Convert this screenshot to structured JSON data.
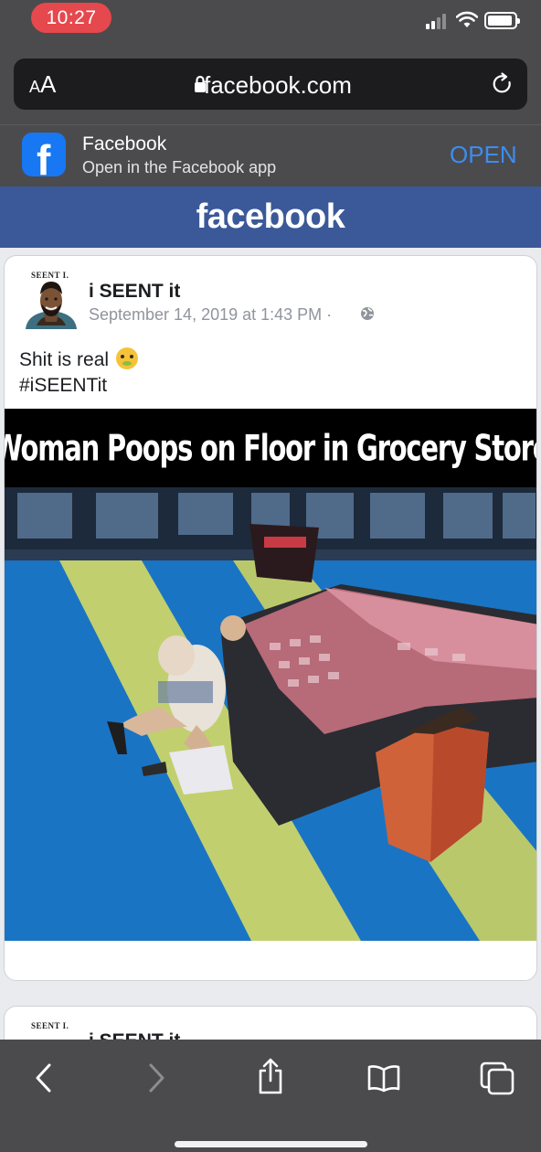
{
  "status_bar": {
    "time": "10:27",
    "time_pill_color": "#e5484d",
    "icons": [
      "cellular-signal-icon",
      "wifi-icon",
      "battery-icon"
    ]
  },
  "browser": {
    "text_size_button": {
      "big": "A",
      "small": "A"
    },
    "url": "facebook.com",
    "icons": [
      "lock-icon",
      "reload-icon"
    ]
  },
  "app_banner": {
    "title": "Facebook",
    "subtitle": "Open in the Facebook app",
    "action": "OPEN",
    "icon": "facebook-app-icon",
    "action_color": "#3d8cf0"
  },
  "header": {
    "logo": "facebook",
    "color": "#3b5998"
  },
  "post": {
    "avatar_label": "SEENT I.",
    "page_name": "i SEENT it",
    "date": "September 14, 2019 at 1:43 PM · ",
    "privacy_icon": "globe-icon",
    "text_line1": "Shit is real ",
    "emoji": "nauseated-face-emoji",
    "text_line2": "#iSEENTit",
    "media_caption": "\"Woman Poops on Floor in Grocery Store\""
  },
  "next_post": {
    "avatar_label": "SEENT I.",
    "page_name": "i SEENT it"
  },
  "toolbar": {
    "items": [
      "back-icon",
      "forward-icon",
      "share-icon",
      "bookmarks-icon",
      "tabs-icon"
    ]
  }
}
